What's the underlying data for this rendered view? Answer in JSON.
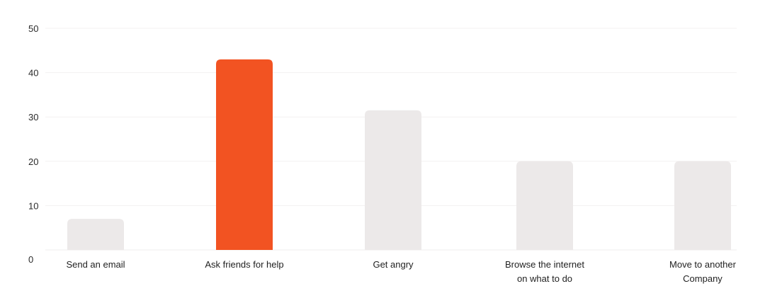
{
  "chart_data": {
    "type": "bar",
    "title": "",
    "xlabel": "",
    "ylabel": "",
    "categories": [
      "Send an email",
      "Ask friends for help",
      "Get angry",
      "Browse the internet on what to do",
      "Move to another Company"
    ],
    "category_label_lines": [
      [
        "Send an email"
      ],
      [
        "Ask friends for help"
      ],
      [
        "Get angry"
      ],
      [
        "Browse the internet",
        "on what to do"
      ],
      [
        "Move to another",
        "Company"
      ]
    ],
    "values": [
      7,
      43,
      31.5,
      20,
      20
    ],
    "highlight_index": 1,
    "ylim": [
      0,
      50
    ],
    "yticks": [
      0,
      10,
      20,
      30,
      40,
      50
    ],
    "grid": true,
    "legend": "none",
    "colors": {
      "highlight": "#f25322",
      "bar": "#ece9e9",
      "gridline": "#f3f1f1",
      "text": "#2b2b2b"
    }
  }
}
